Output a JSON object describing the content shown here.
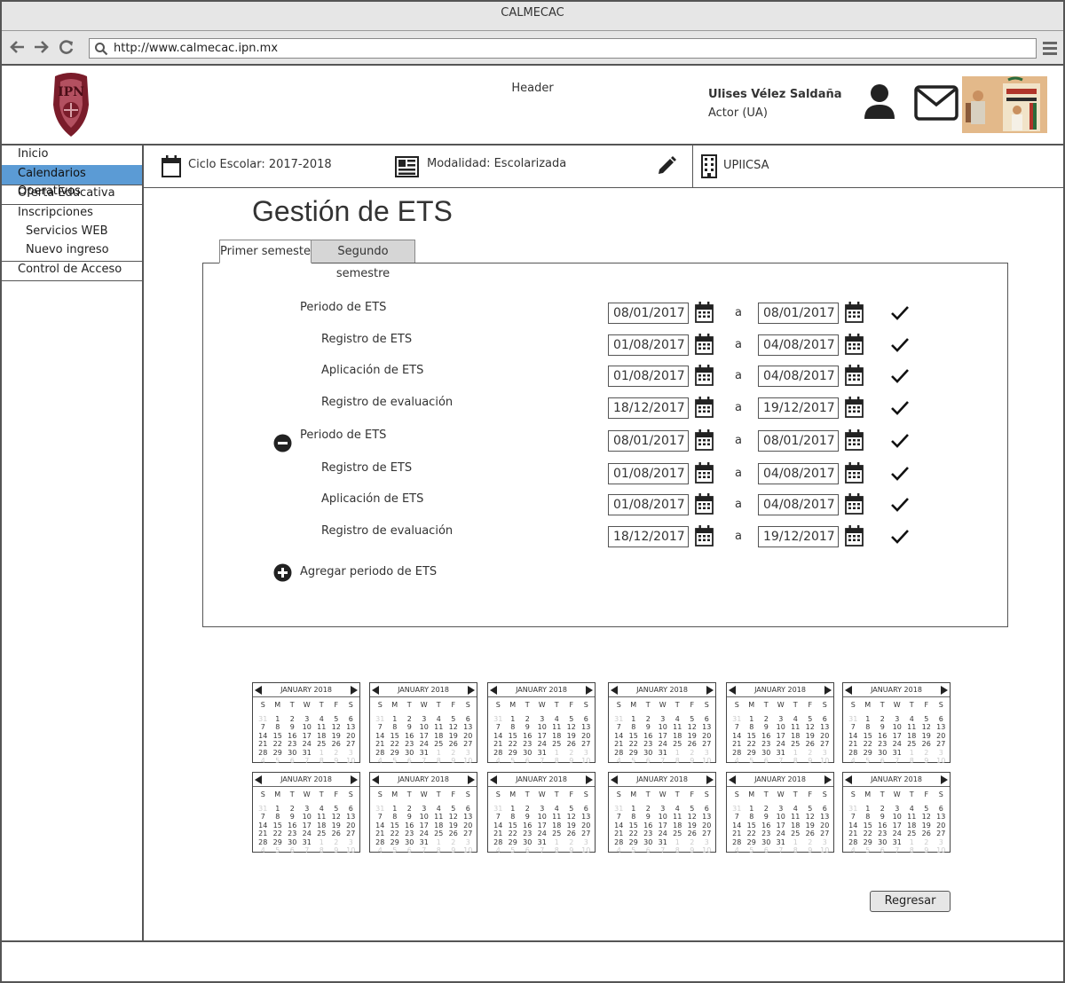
{
  "window": {
    "title": "CALMECAC"
  },
  "browser": {
    "url": "http://www.calmecac.ipn.mx"
  },
  "header": {
    "label": "Header",
    "user_name": "Ulises Vélez Saldaña",
    "user_role": "Actor (UA)"
  },
  "sidebar": {
    "items": [
      {
        "label": "Inicio",
        "selected": false
      },
      {
        "label": "Calendarios Operativos",
        "selected": true
      },
      {
        "label": "Oferta Educativa",
        "selected": false
      },
      {
        "label": "Inscripciones",
        "selected": false
      },
      {
        "label": "Servicios WEB",
        "selected": false
      },
      {
        "label": "Nuevo ingreso",
        "selected": false
      },
      {
        "label": "Control de Acceso",
        "selected": false
      }
    ]
  },
  "infobar": {
    "ciclo": "Ciclo Escolar: 2017-2018",
    "modalidad": "Modalidad: Escolarizada",
    "escuela": "UPIICSA"
  },
  "main": {
    "title": "Gestión de ETS",
    "tabs": [
      "Primer semeste",
      "Segundo semestre"
    ],
    "active_tab": 0,
    "range_separator": "a",
    "rows": [
      {
        "label": "Periodo de ETS",
        "from": "08/01/2017",
        "to": "08/01/2017"
      },
      {
        "label": "Registro de ETS",
        "from": "01/08/2017",
        "to": "04/08/2017"
      },
      {
        "label": "Aplicación de ETS",
        "from": "01/08/2017",
        "to": "04/08/2017"
      },
      {
        "label": "Registro de evaluación",
        "from": "18/12/2017",
        "to": "19/12/2017"
      },
      {
        "label": "Periodo de ETS",
        "from": "08/01/2017",
        "to": "08/01/2017"
      },
      {
        "label": "Registro de ETS",
        "from": "01/08/2017",
        "to": "04/08/2017"
      },
      {
        "label": "Aplicación de ETS",
        "from": "01/08/2017",
        "to": "04/08/2017"
      },
      {
        "label": "Registro de evaluación",
        "from": "18/12/2017",
        "to": "19/12/2017"
      }
    ],
    "add_label": "Agregar periodo de ETS",
    "back_button": "Regresar"
  },
  "calendars": {
    "month_label": "JANUARY 2018",
    "weekdays": [
      "S",
      "M",
      "T",
      "W",
      "T",
      "F",
      "S"
    ],
    "weeks": [
      [
        "31",
        "1",
        "2",
        "3",
        "4",
        "5",
        "6"
      ],
      [
        "7",
        "8",
        "9",
        "10",
        "11",
        "12",
        "13"
      ],
      [
        "14",
        "15",
        "16",
        "17",
        "18",
        "19",
        "20"
      ],
      [
        "21",
        "22",
        "23",
        "24",
        "25",
        "26",
        "27"
      ],
      [
        "28",
        "29",
        "30",
        "31",
        "1",
        "2",
        "3"
      ],
      [
        "4",
        "5",
        "6",
        "7",
        "8",
        "9",
        "10"
      ]
    ],
    "count": 12
  },
  "colors": {
    "selected_nav": "#5b9bd5",
    "logo": "#7a1c2a"
  },
  "icons": [
    "back-arrow-icon",
    "forward-arrow-icon",
    "reload-icon",
    "search-icon",
    "hamburger-menu-icon",
    "user-icon",
    "mail-icon",
    "calendar-icon",
    "newspaper-icon",
    "pencil-icon",
    "building-icon",
    "check-icon",
    "minus-circle-icon",
    "plus-circle-icon"
  ]
}
